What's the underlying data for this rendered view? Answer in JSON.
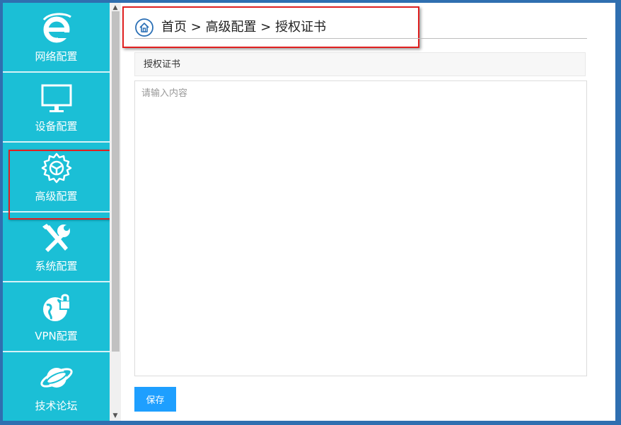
{
  "sidebar": {
    "items": [
      {
        "label": "网络配置",
        "icon": "ie-icon"
      },
      {
        "label": "设备配置",
        "icon": "monitor-icon"
      },
      {
        "label": "高级配置",
        "icon": "gear-icon",
        "highlighted": true
      },
      {
        "label": "系统配置",
        "icon": "tools-icon"
      },
      {
        "label": "VPN配置",
        "icon": "globe-lock-icon"
      },
      {
        "label": "技术论坛",
        "icon": "planet-icon"
      }
    ]
  },
  "breadcrumb": {
    "home": "首页",
    "sep1": ">",
    "section": "高级配置",
    "sep2": ">",
    "page": "授权证书"
  },
  "main": {
    "section_title": "授权证书",
    "textarea_placeholder": "请输入内容",
    "textarea_value": "",
    "save_label": "保存"
  },
  "colors": {
    "sidebar_bg": "#1bbfd6",
    "highlight_border": "#e02020",
    "button_bg": "#1e9fff"
  }
}
